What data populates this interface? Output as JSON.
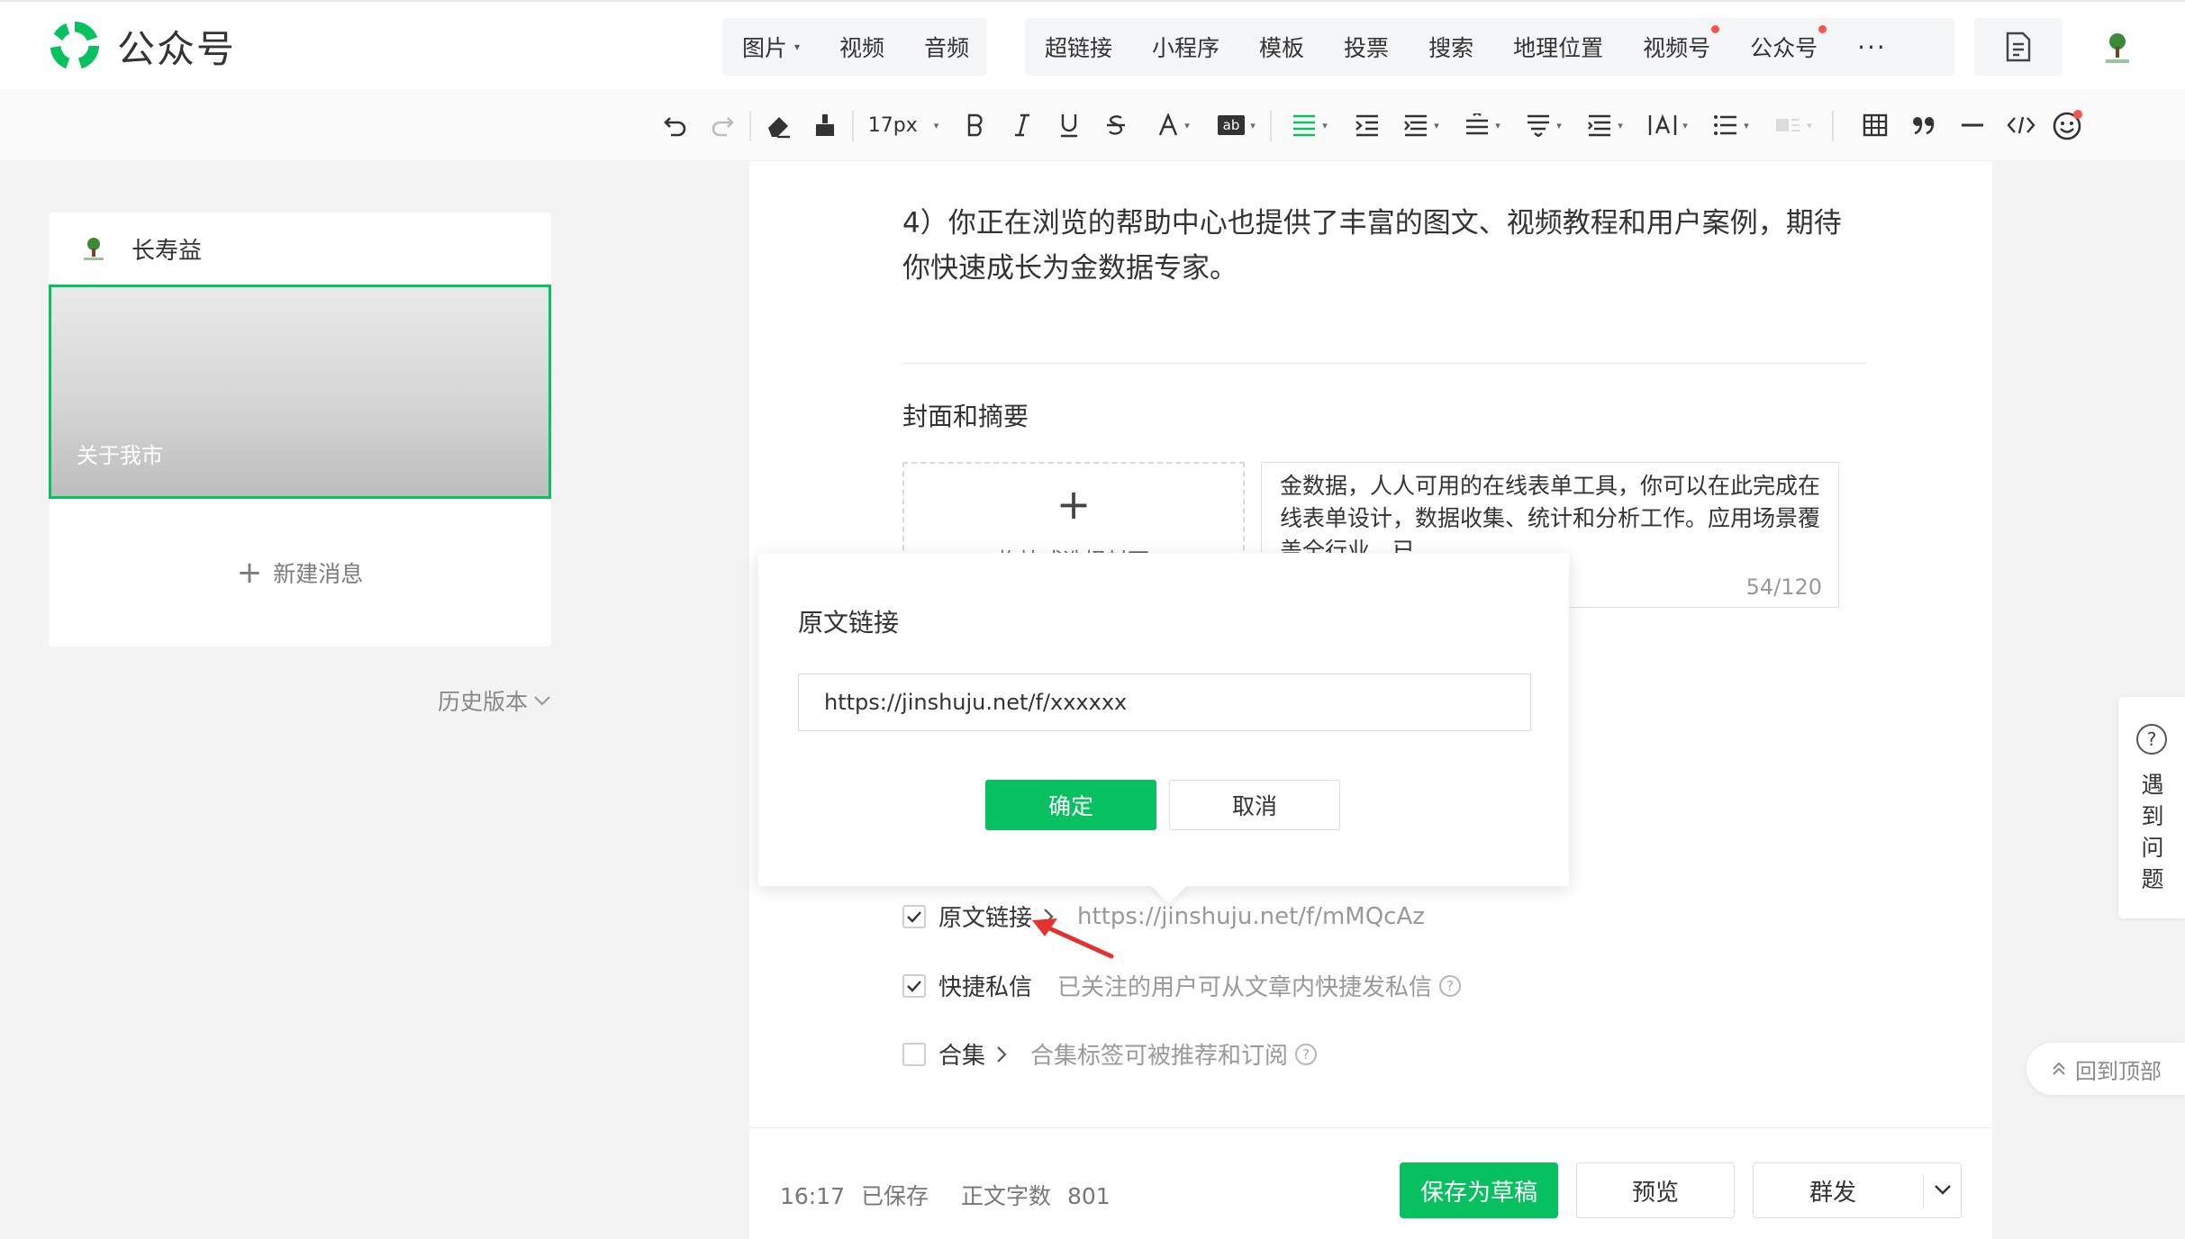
{
  "topbar": {
    "brand": "公众号",
    "insert_media": [
      {
        "label": "图片",
        "has_caret": true
      },
      {
        "label": "视频"
      },
      {
        "label": "音频"
      }
    ],
    "insert_items": [
      {
        "label": "超链接"
      },
      {
        "label": "小程序"
      },
      {
        "label": "模板"
      },
      {
        "label": "投票"
      },
      {
        "label": "搜索"
      },
      {
        "label": "地理位置"
      },
      {
        "label": "视频号",
        "red_dot": true
      },
      {
        "label": "公众号",
        "red_dot": true
      }
    ],
    "more": "···"
  },
  "toolbar": {
    "font_size": "17px"
  },
  "left": {
    "account_name": "长寿益",
    "cover_title": "关于我市",
    "new_message": "新建消息",
    "history": "历史版本"
  },
  "editor": {
    "paragraph": "4）你正在浏览的帮助中心也提供了丰富的图文、视频教程和用户案例，期待你快速成长为金数据专家。",
    "section_title": "封面和摘要",
    "cover_hint": "拖拽或选择封面",
    "summary": "金数据，人人可用的在线表单工具，你可以在此完成在线表单设计，数据收集、统计和分析工作。应用场景覆盖全行业，已",
    "summary_count": "54/120",
    "options": [
      {
        "label": "原文链接",
        "checked": true,
        "desc": "https://jinshuju.net/f/mMQcAz"
      },
      {
        "label": "快捷私信",
        "checked": true,
        "desc": "已关注的用户可从文章内快捷发私信"
      },
      {
        "label": "合集",
        "checked": false,
        "desc": "合集标签可被推荐和订阅"
      }
    ]
  },
  "dialog": {
    "title": "原文链接",
    "input_value": "https://jinshuju.net/f/xxxxxx",
    "confirm": "确定",
    "cancel": "取消"
  },
  "bottom": {
    "save_time": "16:17",
    "save_state": "已保存",
    "word_count_label": "正文字数",
    "word_count": "801",
    "save_draft": "保存为草稿",
    "preview": "预览",
    "publish": "群发"
  },
  "float": {
    "help": "遇到问题",
    "back_top": "回到顶部"
  },
  "colors": {
    "brand_green": "#07c160",
    "red_dot": "#fa5151",
    "annotation_arrow": "#e5312f"
  }
}
